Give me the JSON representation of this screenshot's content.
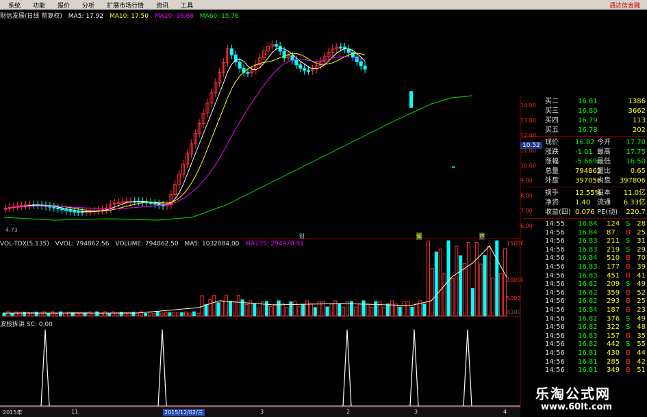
{
  "menu": {
    "items": [
      "系统",
      "功能",
      "报价",
      "分析",
      "扩展市场行情",
      "资讯",
      "工具"
    ],
    "brand": "通达信金融"
  },
  "chart": {
    "title": "财信发展(日线 前复权)",
    "ma": [
      {
        "label": "MA5: 17.92",
        "color": "#ffffff"
      },
      {
        "label": "MA10: 17.50",
        "color": "#ffff00"
      },
      {
        "label": "MA20: 16.68",
        "color": "#ff00ff"
      },
      {
        "label": "MA60: 15.76",
        "color": "#00ff00"
      }
    ],
    "low_label": "4.73",
    "time_badge": "10.52",
    "price_ticks": [
      "14.00",
      "13.00",
      "12.00",
      "11.00",
      "10.00",
      "9.00",
      "8.00",
      "7.00",
      "6.00"
    ],
    "markers": [
      "财",
      "诚",
      "荐"
    ]
  },
  "volume": {
    "header": [
      {
        "label": "VOL-TDX(5,135)",
        "color": "#ffffff"
      },
      {
        "label": "VVOL: 794862.56",
        "color": "#ffffff"
      },
      {
        "label": "VOLUME: 794862.50",
        "color": "#ffffff"
      },
      {
        "label": "MA5: 1032084.00",
        "color": "#ffffff"
      },
      {
        "label": "MA135: 294970.91",
        "color": "#ff00ff"
      }
    ],
    "ticks": [
      "15000",
      "10000",
      "5000",
      "X100"
    ]
  },
  "indicator": {
    "header": "波段拆讲 SC: 0.00"
  },
  "dates": {
    "year": "2015年",
    "d1": "11",
    "d2": "2015/12/02/三",
    "d3": "3",
    "d4": "2",
    "d5": "3",
    "d6": "4"
  },
  "quote": {
    "bids": [
      {
        "name": "买二",
        "price": "16.81",
        "vol": "1386"
      },
      {
        "name": "买三",
        "price": "16.80",
        "vol": "3662"
      },
      {
        "name": "买四",
        "price": "16.79",
        "vol": "113"
      },
      {
        "name": "买五",
        "price": "16.78",
        "vol": "202"
      }
    ],
    "stats1": [
      {
        "k1": "现价",
        "v1": "16.82",
        "k2": "今开",
        "v2": "17.70"
      },
      {
        "k1": "涨跌",
        "v1": "-1.01",
        "k2": "最高",
        "v2": "17.75"
      },
      {
        "k1": "涨幅",
        "v1": "-5.66%",
        "k2": "最低",
        "v2": "16.50"
      },
      {
        "k1": "总量",
        "v1": "794862",
        "k2": "量比",
        "v2": "0.65"
      },
      {
        "k1": "外盘",
        "v1": "397056",
        "k2": "内盘",
        "v2": "397806"
      }
    ],
    "stats2": [
      {
        "k1": "换手",
        "v1": "12.55%",
        "k2": "股本",
        "v2": "11.0亿"
      },
      {
        "k1": "净资",
        "v1": "1.40",
        "k2": "流通",
        "v2": "6.33亿"
      },
      {
        "k1": "收益(四)",
        "v1": "0.076",
        "k2": "PE(动)",
        "v2": "220.7"
      }
    ],
    "ticks": [
      {
        "t": "14:55",
        "p": "16.84",
        "v": "124",
        "d": "S",
        "n": "28"
      },
      {
        "t": "14:56",
        "p": "16.84",
        "v": "87",
        "d": "B",
        "n": "25"
      },
      {
        "t": "14:56",
        "p": "16.83",
        "v": "211",
        "d": "S",
        "n": "31"
      },
      {
        "t": "14:56",
        "p": "16.83",
        "v": "219",
        "d": "S",
        "n": "29"
      },
      {
        "t": "14:56",
        "p": "16.84",
        "v": "510",
        "d": "B",
        "n": "70"
      },
      {
        "t": "14:56",
        "p": "16.83",
        "v": "177",
        "d": "B",
        "n": "39"
      },
      {
        "t": "14:56",
        "p": "16.83",
        "v": "451",
        "d": "B",
        "n": "41"
      },
      {
        "t": "14:56",
        "p": "16.82",
        "v": "209",
        "d": "S",
        "n": "49"
      },
      {
        "t": "14:56",
        "p": "16.82",
        "v": "359",
        "d": "B",
        "n": "52"
      },
      {
        "t": "14:56",
        "p": "16.82",
        "v": "293",
        "d": "B",
        "n": "25"
      },
      {
        "t": "14:56",
        "p": "16.84",
        "v": "187",
        "d": "B",
        "n": "23"
      },
      {
        "t": "14:56",
        "p": "16.82",
        "v": "376",
        "d": "S",
        "n": "49"
      },
      {
        "t": "14:56",
        "p": "16.82",
        "v": "322",
        "d": "S",
        "n": "48"
      },
      {
        "t": "14:56",
        "p": "16.83",
        "v": "157",
        "d": "B",
        "n": "35"
      },
      {
        "t": "14:56",
        "p": "16.82",
        "v": "442",
        "d": "S",
        "n": "55"
      },
      {
        "t": "14:56",
        "p": "16.81",
        "v": "430",
        "d": "B",
        "n": "44"
      },
      {
        "t": "14:56",
        "p": "16.81",
        "v": "285",
        "d": "B",
        "n": "42"
      },
      {
        "t": "14:56",
        "p": "16.81",
        "v": "349",
        "d": "B",
        "n": "51"
      }
    ]
  },
  "watermark": {
    "line1": "乐淘公式网",
    "line2": "www.60lt.com"
  }
}
